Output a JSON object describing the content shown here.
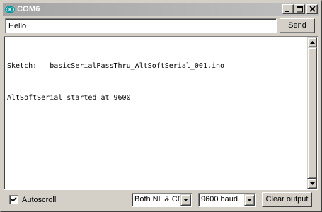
{
  "window": {
    "title": "COM6",
    "app_icon": "arduino-logo-icon",
    "controls": [
      "minimize-icon",
      "maximize-icon",
      "close-icon"
    ]
  },
  "send": {
    "input_value": "Hello",
    "button_label": "Send"
  },
  "output": {
    "lines": [
      "Sketch:   basicSerialPassThru_AltSoftSerial_001.ino",
      "AltSoftSerial started at 9600"
    ]
  },
  "footer": {
    "autoscroll_label": "Autoscroll",
    "autoscroll_checked": true,
    "line_ending": "Both NL & CR",
    "baud_rate": "9600 baud",
    "clear_label": "Clear output"
  },
  "colors": {
    "face": "#d4d0c8",
    "titlebar": "#a5a5a5",
    "arduino_teal": "#00979c"
  }
}
